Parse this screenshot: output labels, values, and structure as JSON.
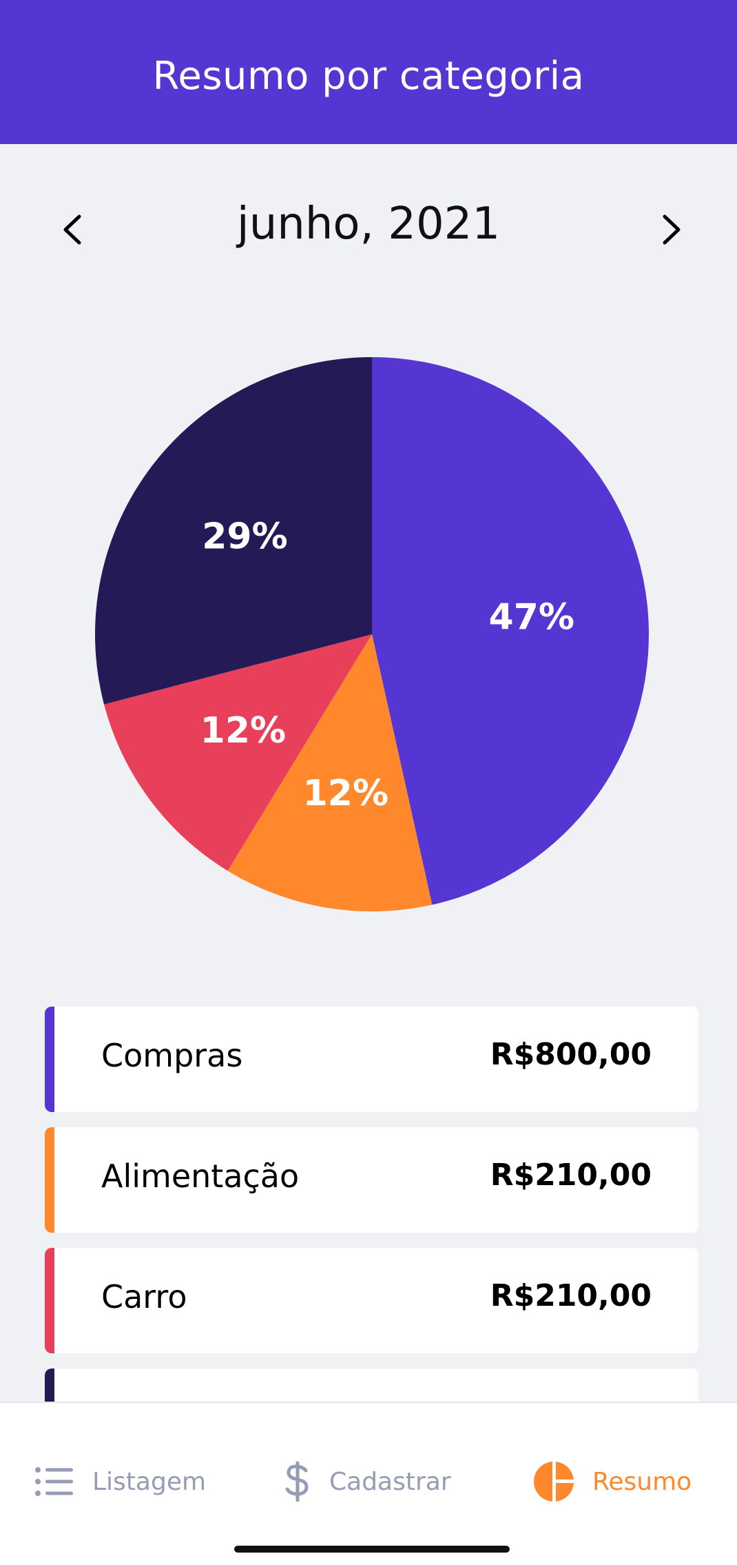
{
  "header": {
    "title": "Resumo por categoria"
  },
  "month_nav": {
    "label": "junho, 2021",
    "prev_icon": "chevron-left-icon",
    "next_icon": "chevron-right-icon"
  },
  "chart_data": {
    "type": "pie",
    "slices": [
      {
        "label": "Compras",
        "value": 800,
        "percent": "47%",
        "color": "#5636d3"
      },
      {
        "label": "Alimentação",
        "value": 210,
        "percent": "12%",
        "color": "#ff872c"
      },
      {
        "label": "Carro",
        "value": 210,
        "percent": "12%",
        "color": "#e83f5b"
      },
      {
        "label": "",
        "value": 500,
        "percent": "29%",
        "color": "#261a56"
      }
    ]
  },
  "categories": [
    {
      "name": "Compras",
      "amount": "R$800,00",
      "color": "#5636d3"
    },
    {
      "name": "Alimentação",
      "amount": "R$210,00",
      "color": "#ff872c"
    },
    {
      "name": "Carro",
      "amount": "R$210,00",
      "color": "#e83f5b"
    },
    {
      "name": "",
      "amount": "",
      "color": "#261a56"
    }
  ],
  "tabs": [
    {
      "label": "Listagem",
      "icon": "list-icon",
      "active": false
    },
    {
      "label": "Cadastrar",
      "icon": "dollar-icon",
      "active": false
    },
    {
      "label": "Resumo",
      "icon": "pie-chart-icon",
      "active": true
    }
  ],
  "colors": {
    "primary": "#5636d3",
    "secondary": "#ff872c",
    "attention": "#e83f5b",
    "dark": "#261a56",
    "background": "#f0f1f5",
    "tab_inactive": "#969cb3"
  }
}
